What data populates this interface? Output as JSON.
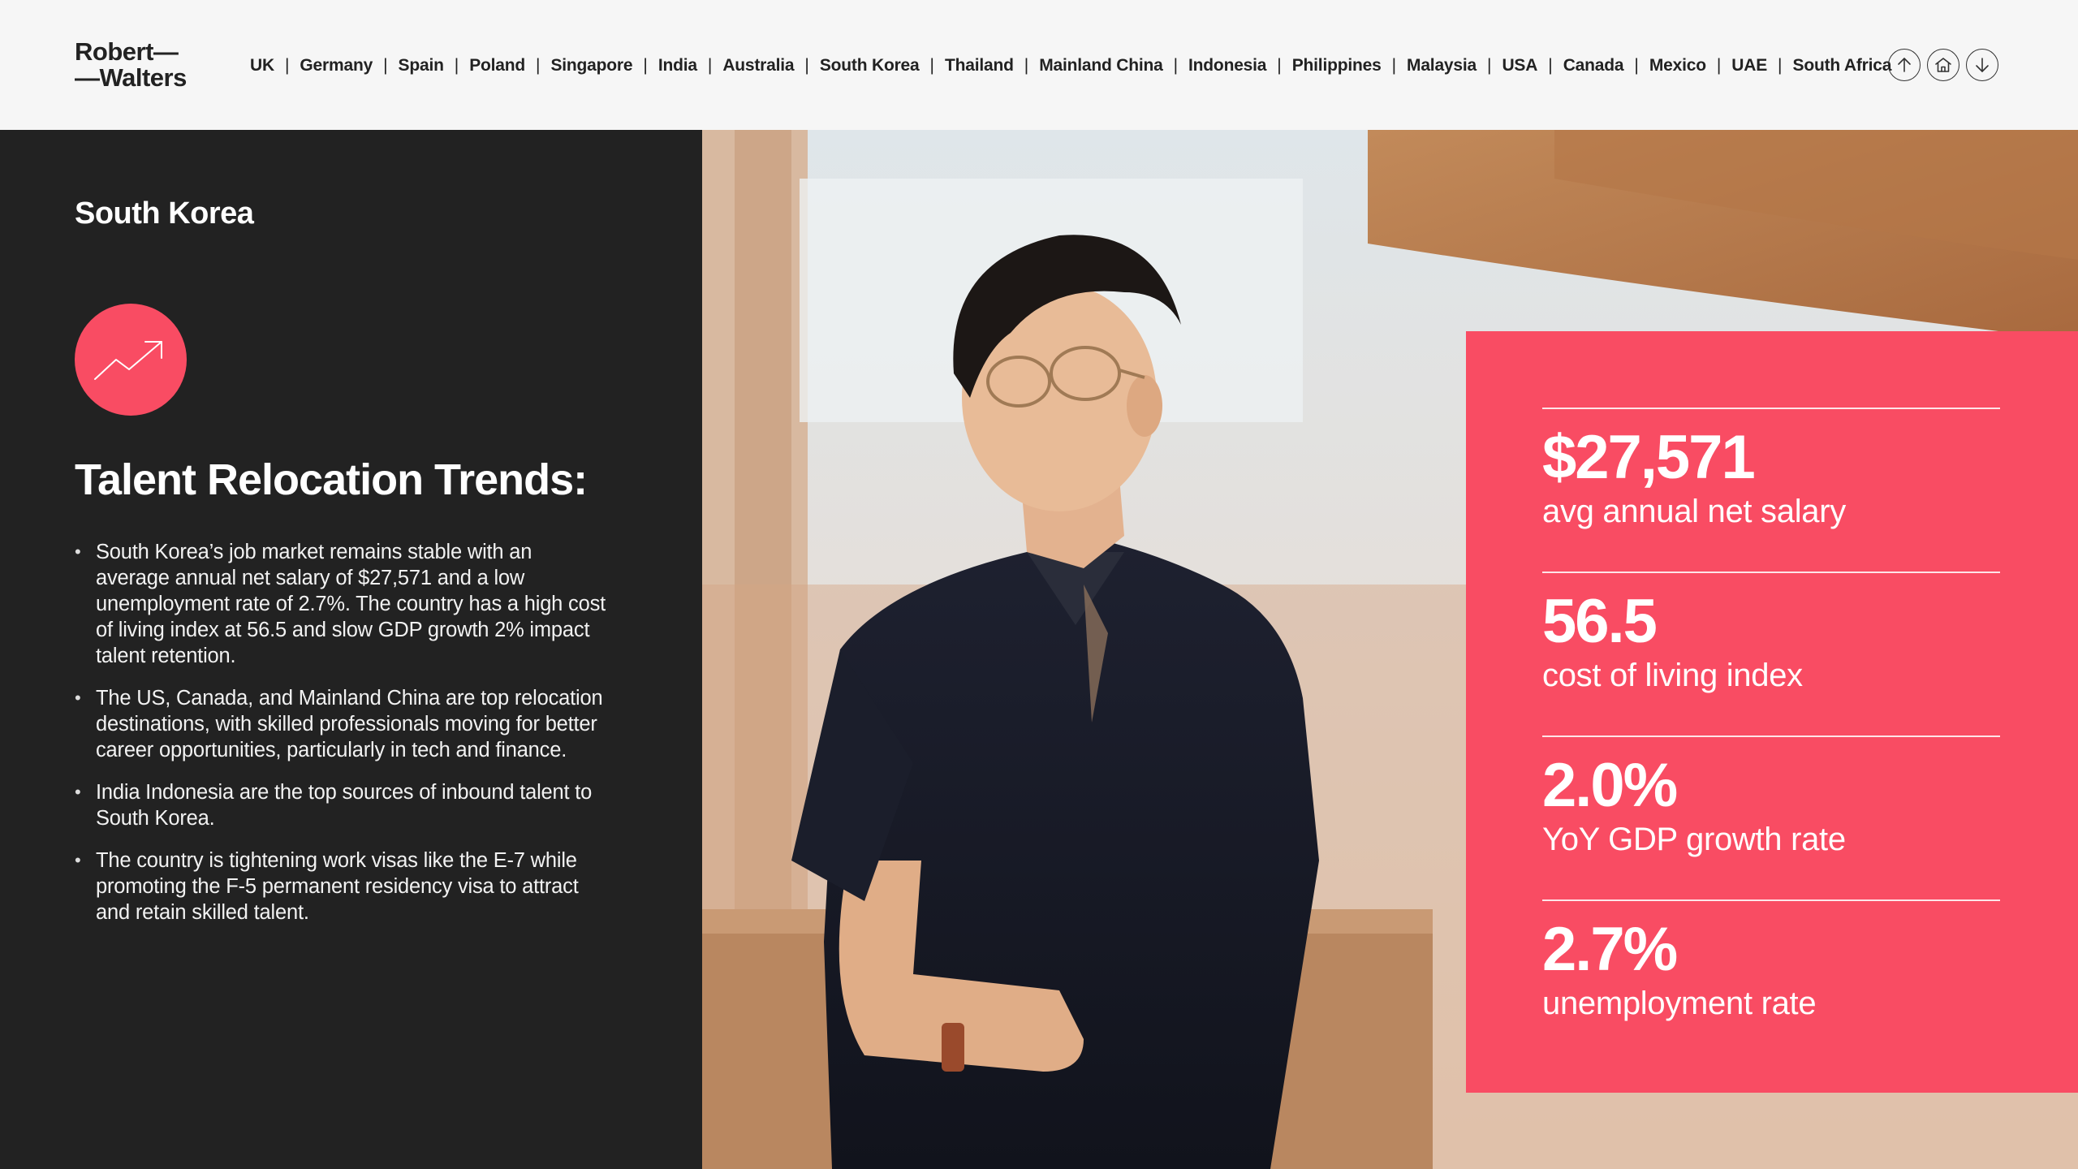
{
  "brand": {
    "line1": "Robert—",
    "line2": "—Walters"
  },
  "nav": {
    "items": [
      "UK",
      "Germany",
      "Spain",
      "Poland",
      "Singapore",
      "India",
      "Australia",
      "South Korea",
      "Thailand",
      "Mainland China",
      "Indonesia",
      "Philippines",
      "Malaysia",
      "USA",
      "Canada",
      "Mexico",
      "UAE",
      "South Africa"
    ],
    "separator": "|"
  },
  "nav_icons": [
    "arrow-up-icon",
    "home-icon",
    "arrow-down-icon"
  ],
  "country": "South Korea",
  "trend_icon": "trending-up-icon",
  "section_title": "Talent Relocation Trends:",
  "bullets": [
    "South Korea’s job market remains stable with an average annual net salary of $27,571 and a low unemployment rate of 2.7%. The country has a high cost of living index at 56.5 and slow GDP growth 2% impact talent retention.",
    "The US, Canada, and Mainland China are top relocation destinations, with skilled professionals moving for better career opportunities, particularly in tech and finance.",
    "India Indonesia are the top sources of inbound talent to South Korea.",
    "The country is tightening work visas like the E-7 while promoting the F-5 permanent residency visa to attract and retain skilled talent."
  ],
  "stats": [
    {
      "value": "$27,571",
      "label": "avg annual net salary"
    },
    {
      "value": "56.5",
      "label": "cost of living index"
    },
    {
      "value": "2.0%",
      "label": "YoY GDP growth rate"
    },
    {
      "value": "2.7%",
      "label": "unemployment rate"
    }
  ],
  "colors": {
    "accent": "#f94c63",
    "dark_panel": "#222222",
    "header_bg": "#f6f6f6"
  }
}
